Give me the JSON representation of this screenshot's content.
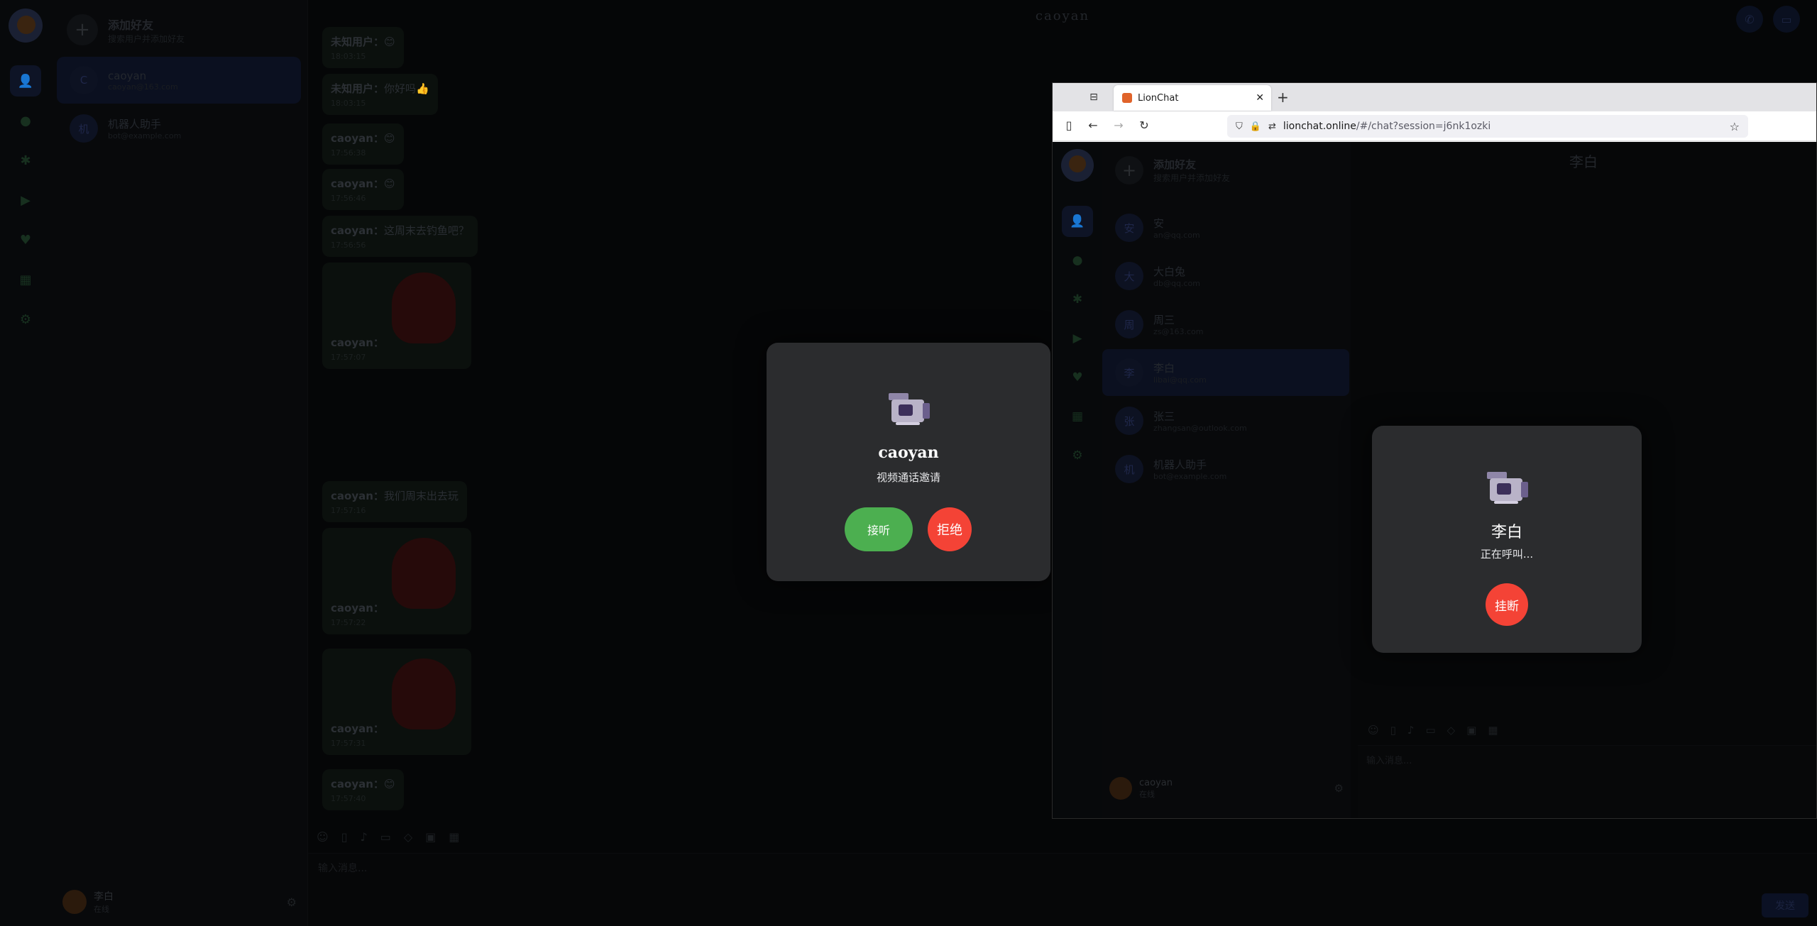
{
  "app": {
    "chat_title": "caoyan",
    "add_friend_title": "添加好友",
    "add_friend_subtitle": "搜索用户并添加好友",
    "contacts": [
      {
        "avatar": "C",
        "name": "caoyan",
        "email": "caoyan@163.com",
        "active": true
      },
      {
        "avatar": "机",
        "name": "机器人助手",
        "email": "bot@example.com",
        "active": false
      }
    ],
    "me": {
      "name": "李白",
      "status": "在线"
    },
    "messages": [
      {
        "who": "未知用户：",
        "text": "😊",
        "time": "18:03:15"
      },
      {
        "who": "未知用户：",
        "text": "你好吗👍",
        "time": "18:03:15"
      },
      {
        "who": "caoyan：",
        "text": "😊",
        "time": "17:56:38"
      },
      {
        "who": "caoyan：",
        "text": "😊",
        "time": "17:56:46"
      },
      {
        "who": "caoyan：",
        "text": "这周末去钓鱼吧？",
        "time": "17:56:56"
      },
      {
        "who": "caoyan：",
        "text": "",
        "time": "17:57:07",
        "sticker": true
      },
      {
        "who": "caoyan：",
        "text": "我们周末出去玩",
        "time": "17:57:16"
      },
      {
        "who": "caoyan：",
        "text": "",
        "time": "17:57:22",
        "sticker": true
      },
      {
        "who": "caoyan：",
        "text": "",
        "time": "17:57:31",
        "sticker": true
      },
      {
        "who": "caoyan：",
        "text": "😊",
        "time": "17:57:40"
      }
    ],
    "composer_placeholder": "输入消息...",
    "send_label": "发送"
  },
  "incoming_call": {
    "caller": "caoyan",
    "subtitle": "视频通话邀请",
    "accept_label": "接听",
    "reject_label": "拒绝"
  },
  "browser": {
    "tab_title": "LionChat",
    "url_host": "lionchat.online",
    "url_path": "/#/chat?session=j6nk1ozki",
    "page": {
      "chat_title": "李白",
      "add_friend_title": "添加好友",
      "add_friend_subtitle": "搜索用户并添加好友",
      "contacts": [
        {
          "avatar": "安",
          "name": "安",
          "email": "an@qq.com",
          "active": false
        },
        {
          "avatar": "大",
          "name": "大白兔",
          "email": "db@qq.com",
          "active": false
        },
        {
          "avatar": "周",
          "name": "周三",
          "email": "zs@163.com",
          "active": false
        },
        {
          "avatar": "李",
          "name": "李白",
          "email": "libai@qq.com",
          "active": true
        },
        {
          "avatar": "张",
          "name": "张三",
          "email": "zhangsan@outlook.com",
          "active": false
        },
        {
          "avatar": "机",
          "name": "机器人助手",
          "email": "bot@example.com",
          "active": false
        }
      ],
      "me": {
        "name": "caoyan",
        "status": "在线"
      },
      "composer_placeholder": "输入消息..."
    },
    "outgoing_call": {
      "callee": "李白",
      "subtitle": "正在呼叫...",
      "hangup_label": "挂断"
    }
  }
}
